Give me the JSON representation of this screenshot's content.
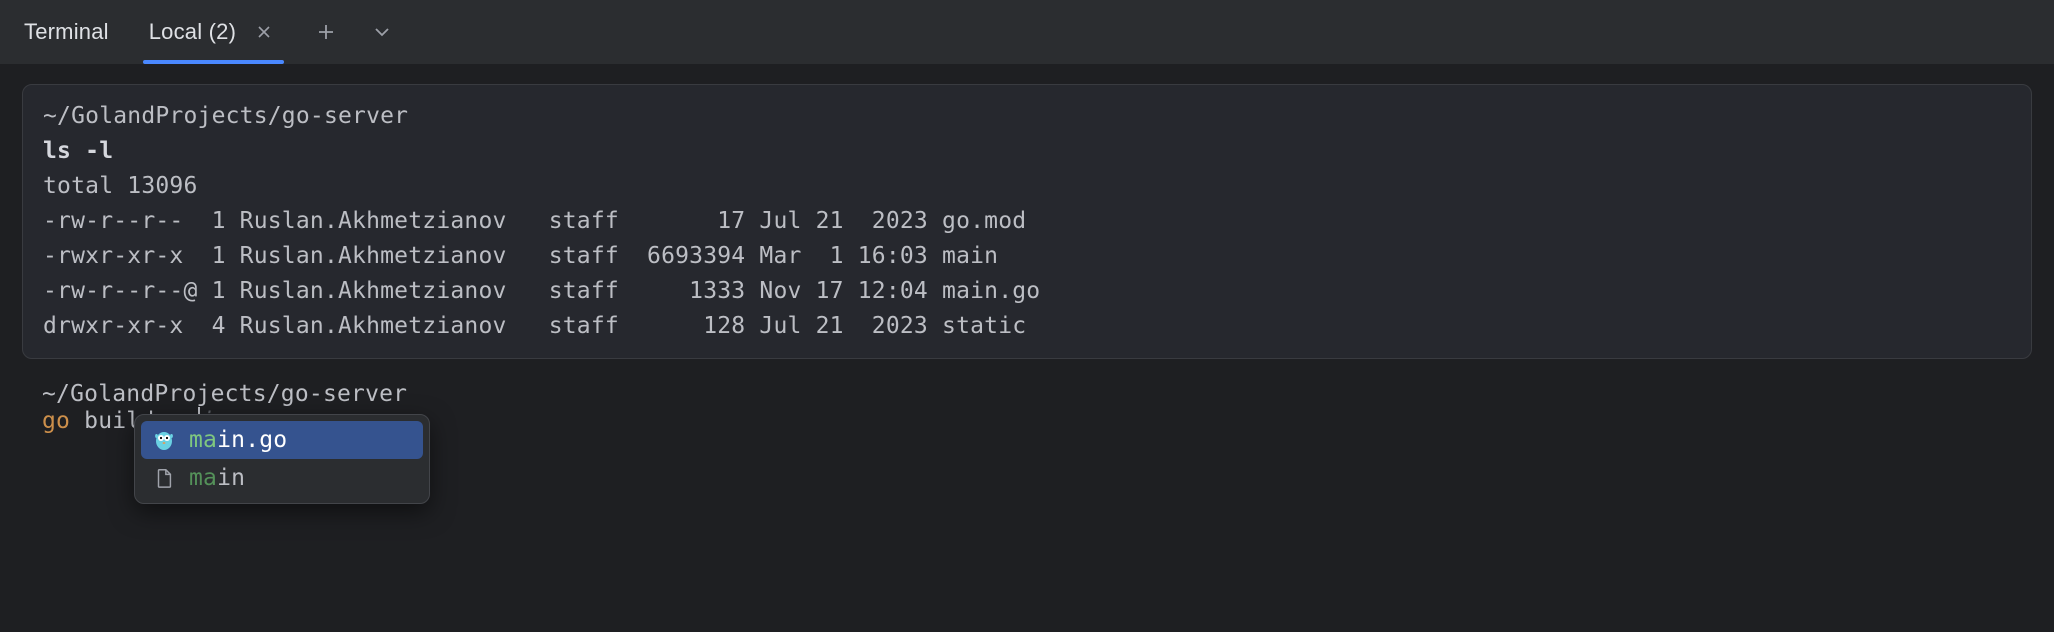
{
  "panel_title": "Terminal",
  "active_tab": "Local (2)",
  "previous_block": {
    "cwd": "~/GolandProjects/go-server",
    "command": "ls -l",
    "total_line": "total 13096",
    "rows": [
      {
        "perm": "-rw-r--r-- ",
        "links": "1",
        "owner": "Ruslan.Akhmetzianov",
        "group": "staff",
        "size": "17",
        "date": "Jul 21  2023",
        "name": "go.mod"
      },
      {
        "perm": "-rwxr-xr-x ",
        "links": "1",
        "owner": "Ruslan.Akhmetzianov",
        "group": "staff",
        "size": "6693394",
        "date": "Mar  1 16:03",
        "name": "main"
      },
      {
        "perm": "-rw-r--r--@",
        "links": "1",
        "owner": "Ruslan.Akhmetzianov",
        "group": "staff",
        "size": "1333",
        "date": "Nov 17 12:04",
        "name": "main.go"
      },
      {
        "perm": "drwxr-xr-x ",
        "links": "4",
        "owner": "Ruslan.Akhmetzianov",
        "group": "staff",
        "size": "128",
        "date": "Jul 21  2023",
        "name": "static"
      }
    ]
  },
  "current_prompt": {
    "cwd": "~/GolandProjects/go-server",
    "go_token": "go",
    "typed_rest": " build ma",
    "ghost": "in.go"
  },
  "completion": {
    "items": [
      {
        "icon": "gopher",
        "match": "ma",
        "rest": "in.go"
      },
      {
        "icon": "file",
        "match": "ma",
        "rest": "in"
      }
    ],
    "selected_index": 0
  }
}
